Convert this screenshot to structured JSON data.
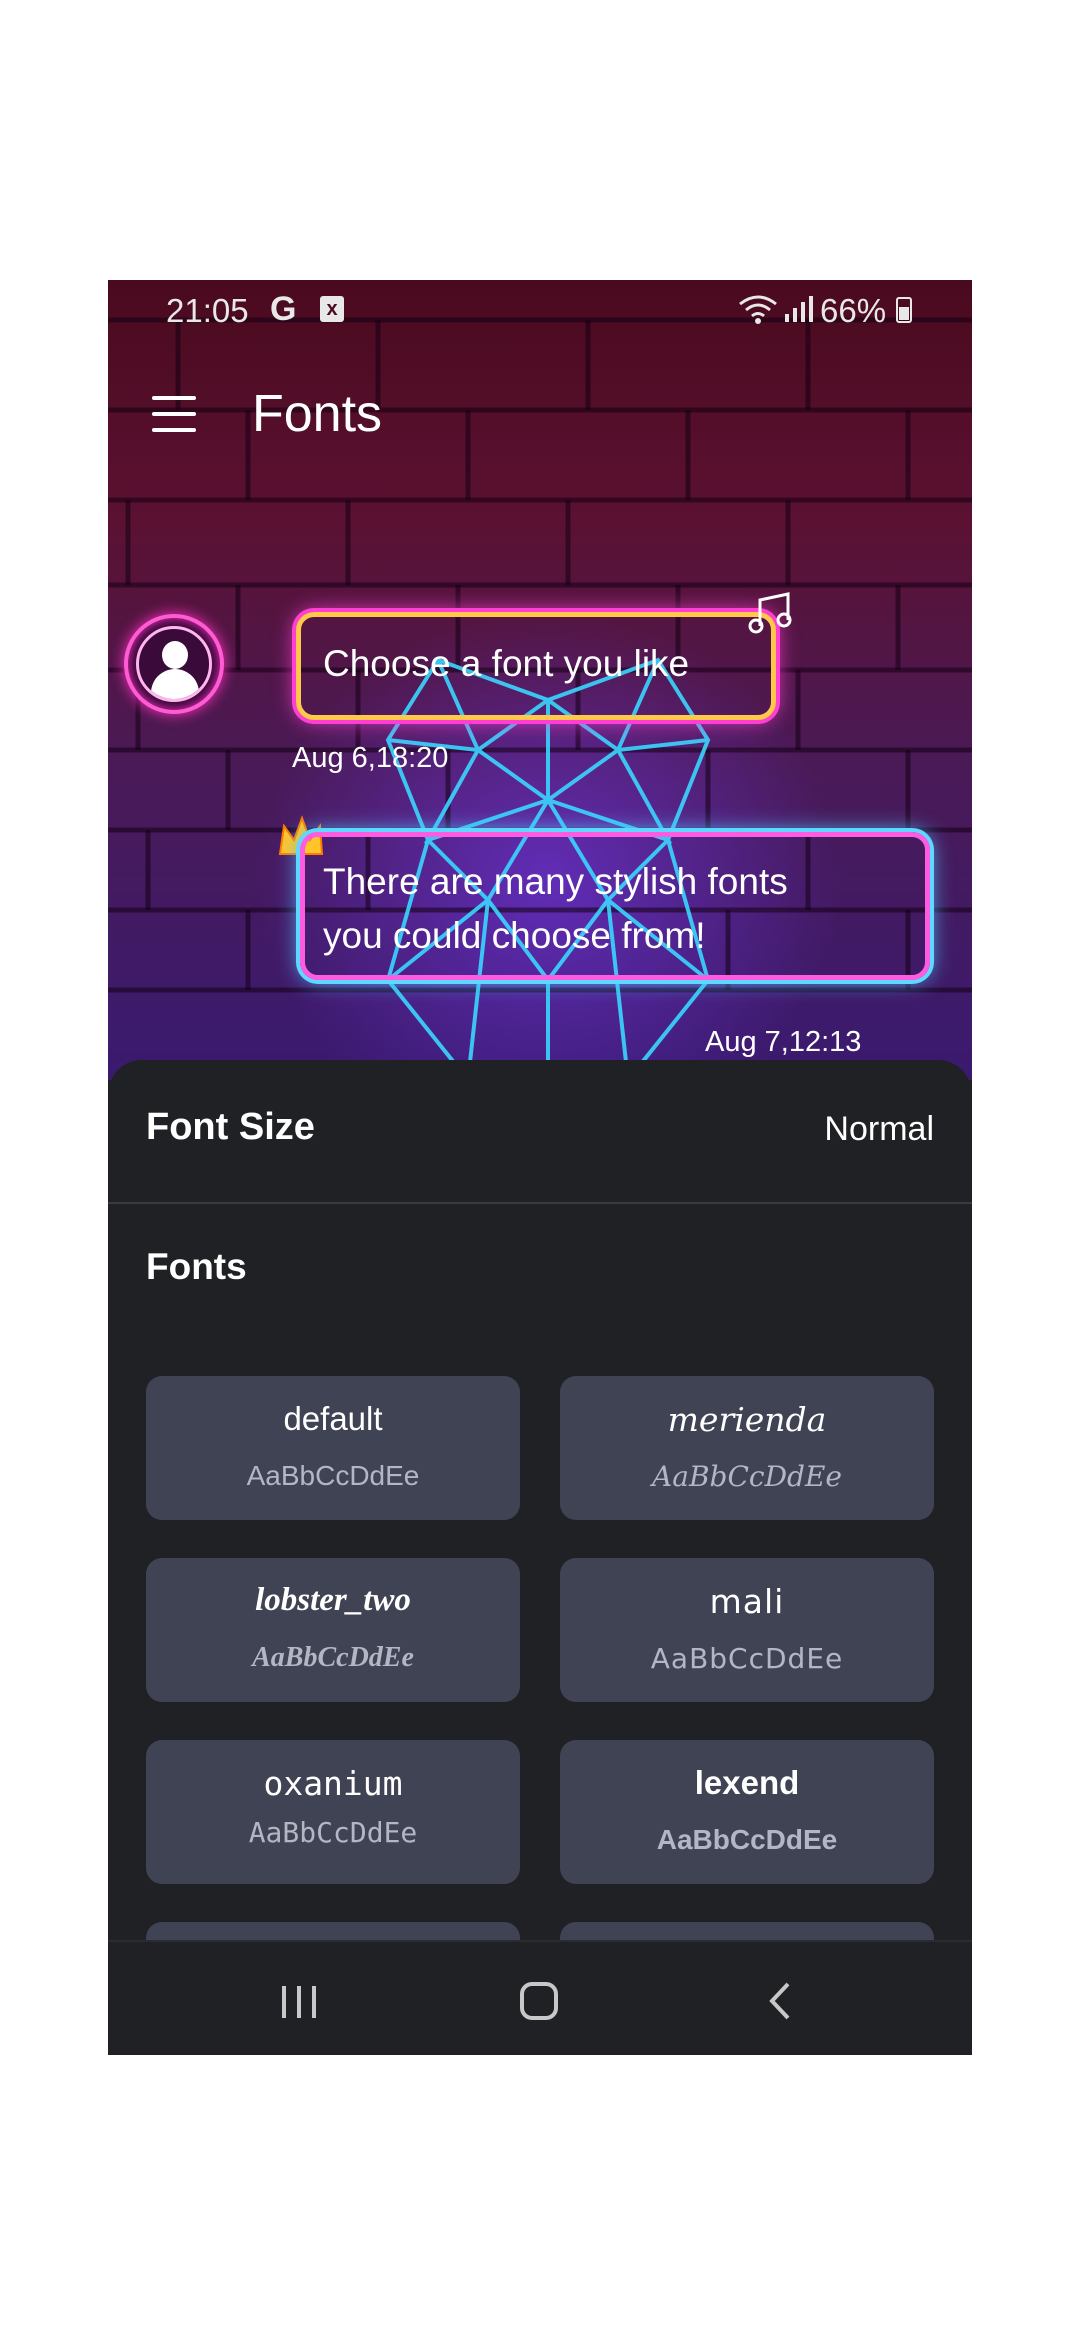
{
  "status_bar": {
    "time": "21:05",
    "g_icon": "G",
    "notification_icon": "x",
    "battery_percent": "66%",
    "icons": [
      "google-icon",
      "notification-x-icon",
      "wifi-icon",
      "signal-icon",
      "battery-charging-icon"
    ]
  },
  "appbar": {
    "title": "Fonts",
    "menu_icon": "hamburger-menu-icon"
  },
  "preview": {
    "messages": [
      {
        "text": "Choose a font you like",
        "timestamp": "Aug 6,18:20",
        "side": "incoming"
      },
      {
        "text_lines": [
          "There are many stylish fonts",
          "you could choose from!"
        ],
        "timestamp": "Aug 7,12:13",
        "side": "outgoing"
      }
    ],
    "colors": {
      "neon_pink": "#ff3fd4",
      "neon_yellow": "#ffc84a",
      "neon_blue": "#4cc6ff"
    }
  },
  "font_size": {
    "label": "Font Size",
    "value": "Normal"
  },
  "fonts_section": {
    "heading": "Fonts",
    "items": [
      {
        "name": "default",
        "sample": "AaBbCcDdEe"
      },
      {
        "name": "merienda",
        "sample": "AaBbCcDdEe"
      },
      {
        "name": "lobster_two",
        "sample": "AaBbCcDdEe"
      },
      {
        "name": "mali",
        "sample": "AaBbCcDdEe"
      },
      {
        "name": "oxanium",
        "sample": "AaBbCcDdEe"
      },
      {
        "name": "lexend",
        "sample": "AaBbCcDdEe"
      }
    ]
  },
  "nav_bar": {
    "buttons": [
      "recent-apps-icon",
      "home-icon",
      "back-icon"
    ]
  },
  "theme": {
    "sheet_background": "#202124",
    "tile_background": "#404353"
  }
}
